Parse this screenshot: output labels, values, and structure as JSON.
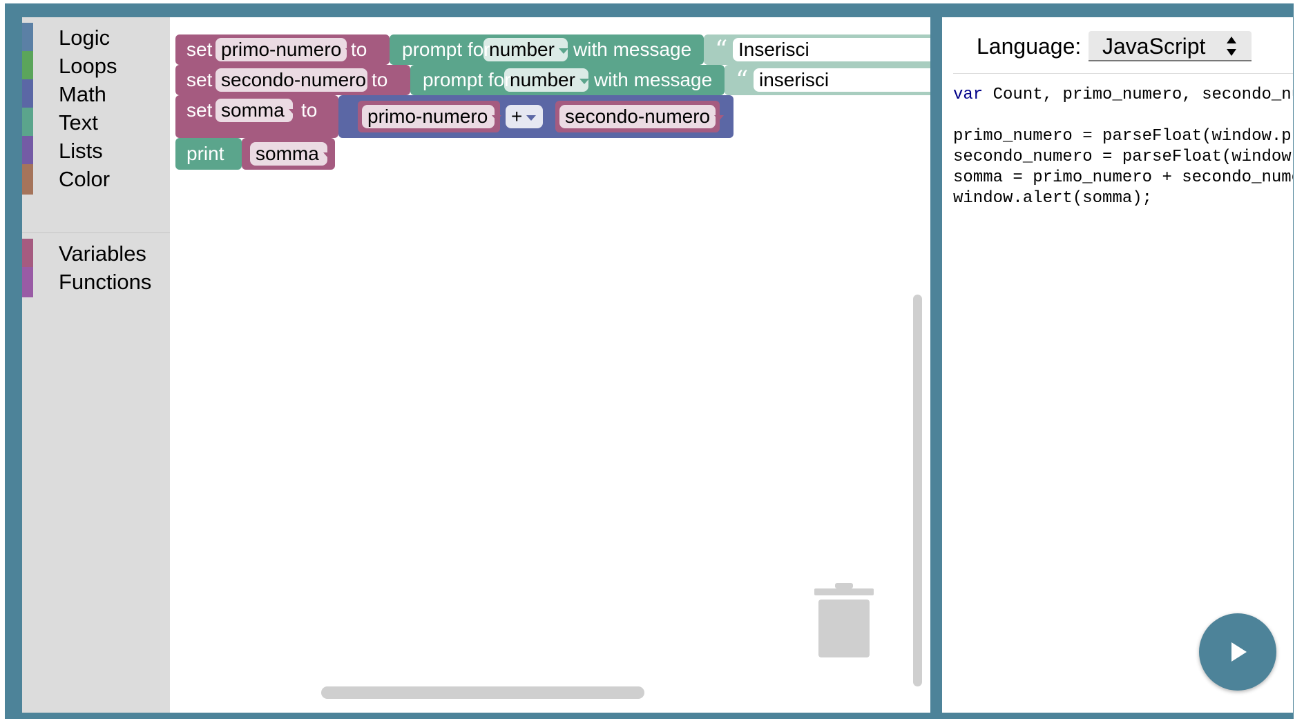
{
  "toolbox": {
    "categories": [
      {
        "label": "Logic",
        "color": "#5b80a5"
      },
      {
        "label": "Loops",
        "color": "#5ba55b"
      },
      {
        "label": "Math",
        "color": "#5b67a5"
      },
      {
        "label": "Text",
        "color": "#5ba58c"
      },
      {
        "label": "Lists",
        "color": "#745ba5"
      },
      {
        "label": "Color",
        "color": "#a5745b"
      },
      {
        "label": "Variables",
        "color": "#a55b80"
      },
      {
        "label": "Functions",
        "color": "#995ba5"
      }
    ]
  },
  "workspace": {
    "block1": {
      "set": "set",
      "var": "primo-numero",
      "to": "to",
      "prompt": "prompt for",
      "type": "number",
      "with_message": "with message",
      "quote": "“",
      "text": "Inserisci"
    },
    "block2": {
      "set": "set",
      "var": "secondo-numero",
      "to": "to",
      "prompt": "prompt for",
      "type": "number",
      "with_message": "with message",
      "quote": "“",
      "text": "inserisci"
    },
    "block3": {
      "set": "set",
      "var": "somma",
      "to": "to",
      "left": "primo-numero",
      "op": "+",
      "right": "secondo-numero"
    },
    "block4": {
      "print": "print",
      "var": "somma"
    }
  },
  "code_panel": {
    "language_label": "Language:",
    "language_value": "JavaScript",
    "code_line1_kw": "var",
    "code_line1_rest": " Count, primo_numero, secondo_numero, somma;",
    "code_body": "\n\nprimo_numero = parseFloat(window.prompt('Inserisci il primo numero'));\nsecondo_numero = parseFloat(window.prompt('inserisci il secondo numero'));\nsomma = primo_numero + secondo_numero;\nwindow.alert(somma);"
  },
  "colors": {
    "frame": "#4d8399",
    "variables": "#a55b80",
    "text": "#5ba58c",
    "math": "#5b67a5"
  },
  "icons": {
    "trash": "trash-icon",
    "run": "play-icon"
  }
}
